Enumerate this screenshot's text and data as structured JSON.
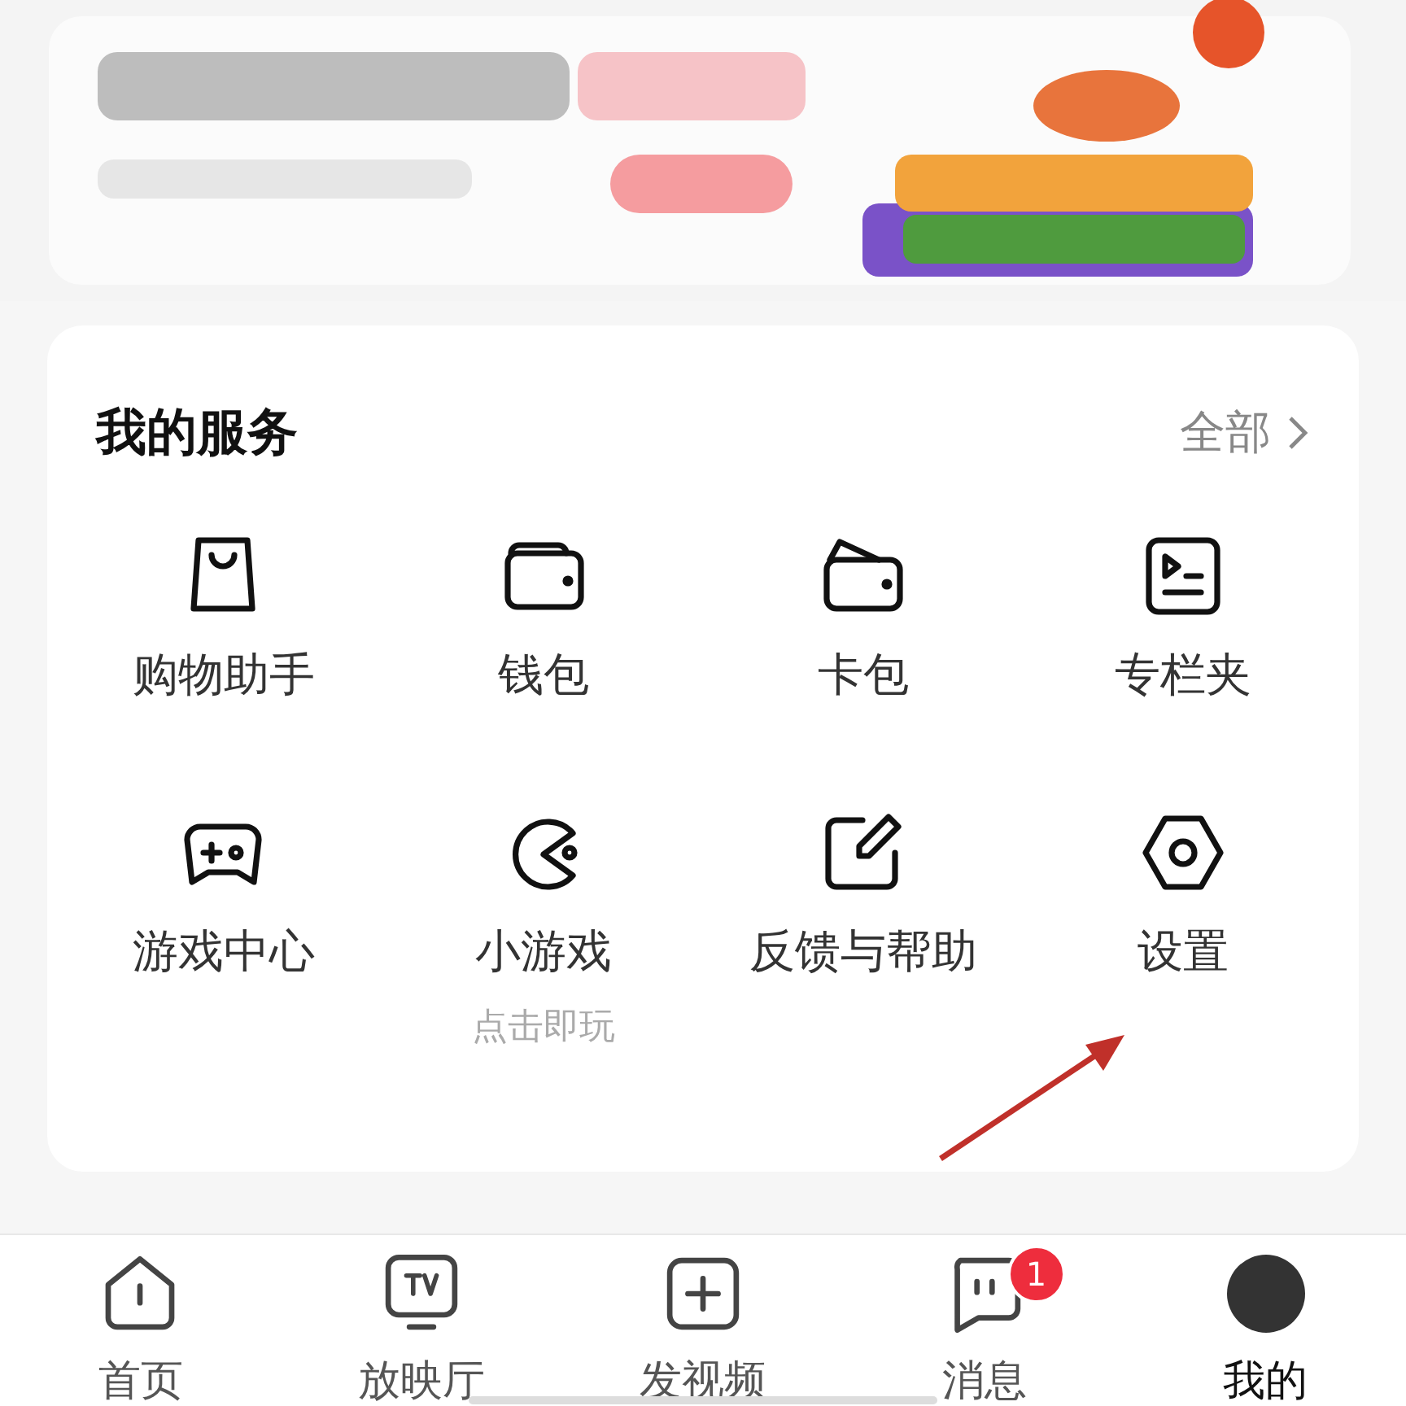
{
  "services": {
    "title": "我的服务",
    "more": "全部",
    "items": [
      {
        "label": "购物助手"
      },
      {
        "label": "钱包"
      },
      {
        "label": "卡包"
      },
      {
        "label": "专栏夹"
      },
      {
        "label": "游戏中心"
      },
      {
        "label": "小游戏",
        "sub": "点击即玩"
      },
      {
        "label": "反馈与帮助"
      },
      {
        "label": "设置"
      }
    ]
  },
  "tabbar": [
    {
      "label": "首页",
      "selected": false
    },
    {
      "label": "放映厅",
      "selected": false
    },
    {
      "label": "发视频",
      "selected": false
    },
    {
      "label": "消息",
      "selected": false,
      "badge": "1"
    },
    {
      "label": "我的",
      "selected": true
    }
  ]
}
